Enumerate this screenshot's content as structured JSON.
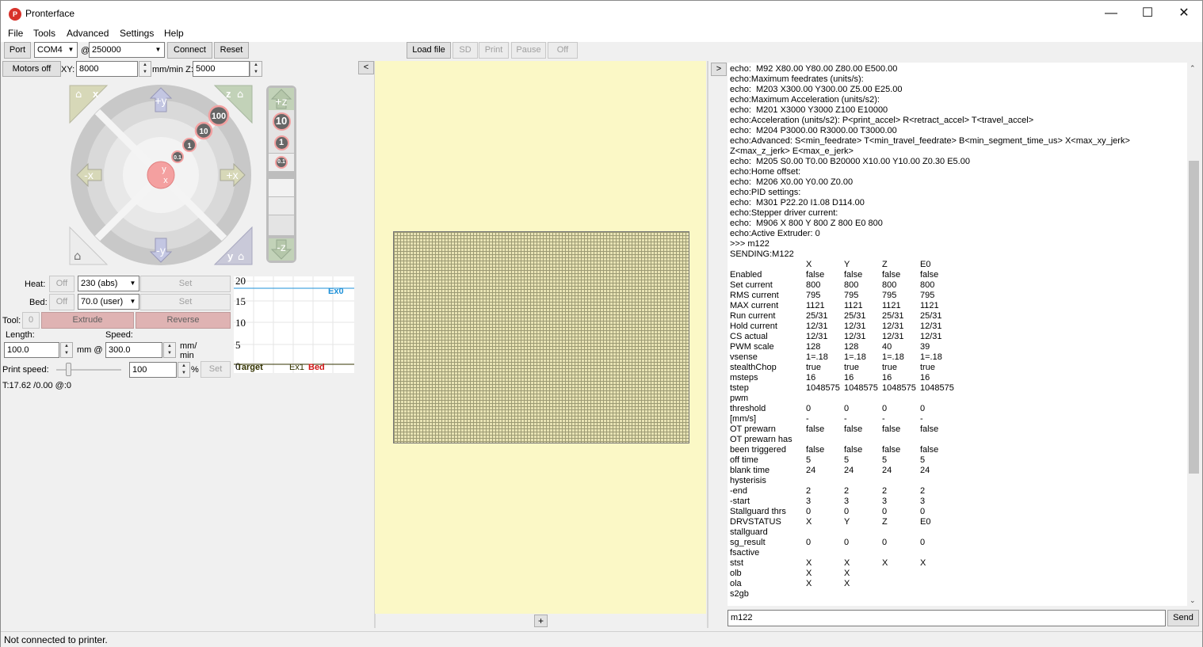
{
  "window": {
    "title": "Pronterface",
    "icon": "pronterface-icon"
  },
  "menu": [
    "File",
    "Tools",
    "Advanced",
    "Settings",
    "Help"
  ],
  "toolbar": {
    "port_label": "Port",
    "port_value": "COM4",
    "at": "@",
    "baud_value": "250000",
    "connect": "Connect",
    "reset": "Reset",
    "load_file": "Load file",
    "sd": "SD",
    "print": "Print",
    "pause": "Pause",
    "off": "Off"
  },
  "motion": {
    "motors_off": "Motors off",
    "xy_label": "XY:",
    "xy_value": "8000",
    "mmmin_label": "mm/min Z:",
    "z_value": "5000"
  },
  "jog": {
    "plus_y": "+y",
    "minus_y": "-y",
    "plus_x": "+x",
    "minus_x": "-x",
    "home_x": "x",
    "home_z": "z",
    "home_y": "y",
    "steps": [
      "100",
      "10",
      "1",
      "0.1"
    ],
    "center_y": "y",
    "center_x": "x"
  },
  "zjog": {
    "plus": "+z",
    "minus": "-z",
    "steps": [
      "10",
      "1",
      "0.1"
    ]
  },
  "temp": {
    "heat_label": "Heat:",
    "heat_off": "Off",
    "heat_value": "230 (abs)",
    "heat_set": "Set",
    "bed_label": "Bed:",
    "bed_off": "Off",
    "bed_value": "70.0 (user)",
    "bed_set": "Set",
    "tool_label": "Tool:",
    "tool_value": "0",
    "extrude": "Extrude",
    "reverse": "Reverse"
  },
  "extrude": {
    "length_label": "Length:",
    "length_value": "100.0",
    "mm_at": "mm @",
    "speed_label": "Speed:",
    "speed_value": "300.0",
    "mm_min_a": "mm/",
    "mm_min_b": "min"
  },
  "printspeed": {
    "label": "Print speed:",
    "value": "100",
    "pct": "%",
    "set": "Set",
    "level": 0.18
  },
  "status_temp": "T:17.62 /0.00 @:0",
  "graph": {
    "ticks": [
      "20",
      "15",
      "10",
      "5",
      "0"
    ],
    "ex0": "Ex0",
    "target": "Target",
    "ex1": "Ex1",
    "bed": "Bed"
  },
  "colors": {
    "ex0": "#1e90d8",
    "bed": "#d01818",
    "ex1": "#333300"
  },
  "panes": {
    "collapse_left": "<",
    "collapse_right": ">",
    "add": "+"
  },
  "log_lines": [
    "echo:  M92 X80.00 Y80.00 Z80.00 E500.00",
    "echo:Maximum feedrates (units/s):",
    "echo:  M203 X300.00 Y300.00 Z5.00 E25.00",
    "echo:Maximum Acceleration (units/s2):",
    "echo:  M201 X3000 Y3000 Z100 E10000",
    "echo:Acceleration (units/s2): P<print_accel> R<retract_accel> T<travel_accel>",
    "echo:  M204 P3000.00 R3000.00 T3000.00",
    "echo:Advanced: S<min_feedrate> T<min_travel_feedrate> B<min_segment_time_us> X<max_xy_jerk>",
    "Z<max_z_jerk> E<max_e_jerk>",
    "echo:  M205 S0.00 T0.00 B20000 X10.00 Y10.00 Z0.30 E5.00",
    "echo:Home offset:",
    "echo:  M206 X0.00 Y0.00 Z0.00",
    "echo:PID settings:",
    "echo:  M301 P22.20 I1.08 D114.00",
    "echo:Stepper driver current:",
    "echo:  M906 X 800 Y 800 Z 800 E0 800",
    "echo:Active Extruder: 0",
    ">>> m122",
    "SENDING:M122"
  ],
  "log_table": [
    [
      "",
      "X",
      "Y",
      "Z",
      "E0"
    ],
    [
      "Enabled",
      "false",
      "false",
      "false",
      "false"
    ],
    [
      "Set current",
      "800",
      "800",
      "800",
      "800"
    ],
    [
      "RMS current",
      "795",
      "795",
      "795",
      "795"
    ],
    [
      "MAX current",
      "1121",
      "1121",
      "1121",
      "1121"
    ],
    [
      "Run current",
      "25/31",
      "25/31",
      "25/31",
      "25/31"
    ],
    [
      "Hold current",
      "12/31",
      "12/31",
      "12/31",
      "12/31"
    ],
    [
      "CS actual",
      "12/31",
      "12/31",
      "12/31",
      "12/31"
    ],
    [
      "PWM scale",
      "128",
      "128",
      "40",
      "39"
    ],
    [
      "vsense",
      "1=.18",
      "1=.18",
      "1=.18",
      "1=.18"
    ],
    [
      "stealthChop",
      "true",
      "true",
      "true",
      "true"
    ],
    [
      "msteps",
      "16",
      "16",
      "16",
      "16"
    ],
    [
      "tstep",
      "1048575",
      "1048575",
      "1048575",
      "1048575"
    ],
    [
      "pwm",
      "",
      "",
      "",
      ""
    ],
    [
      "threshold",
      "0",
      "0",
      "0",
      "0"
    ],
    [
      "[mm/s]",
      "-",
      "-",
      "-",
      "-"
    ],
    [
      "OT prewarn",
      "false",
      "false",
      "false",
      "false"
    ],
    [
      "OT prewarn has",
      "",
      "",
      "",
      ""
    ],
    [
      "been triggered",
      "false",
      "false",
      "false",
      "false"
    ],
    [
      "off time",
      "5",
      "5",
      "5",
      "5"
    ],
    [
      "blank time",
      "24",
      "24",
      "24",
      "24"
    ],
    [
      "hysterisis",
      "",
      "",
      "",
      ""
    ],
    [
      "-end",
      "2",
      "2",
      "2",
      "2"
    ],
    [
      "-start",
      "3",
      "3",
      "3",
      "3"
    ],
    [
      "Stallguard thrs",
      "0",
      "0",
      "0",
      "0"
    ],
    [
      "DRVSTATUS",
      "X",
      "Y",
      "Z",
      "E0"
    ],
    [
      "stallguard",
      "",
      "",
      "",
      ""
    ],
    [
      "sg_result",
      "0",
      "0",
      "0",
      "0"
    ],
    [
      "fsactive",
      "",
      "",
      "",
      ""
    ],
    [
      "stst",
      "X",
      "X",
      "X",
      "X"
    ],
    [
      "olb",
      "X",
      "X",
      "",
      ""
    ],
    [
      "ola",
      "X",
      "X",
      "",
      ""
    ],
    [
      "s2gb",
      "",
      "",
      "",
      ""
    ]
  ],
  "command": {
    "value": "m122",
    "send": "Send"
  },
  "status": "Not connected to printer."
}
